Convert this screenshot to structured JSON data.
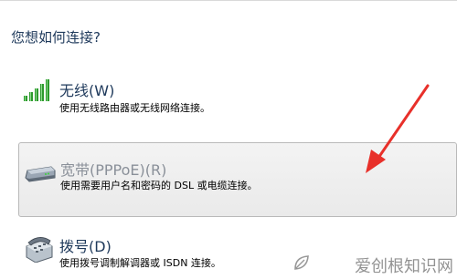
{
  "header": {
    "title": "您想如何连接?"
  },
  "options": [
    {
      "title": "无线(W)",
      "description": "使用无线路由器或无线网络连接。",
      "icon": "wifi-signal-icon"
    },
    {
      "title": "宽带(PPPoE)(R)",
      "description": "使用需要用户名和密码的 DSL 或电缆连接。",
      "icon": "modem-icon"
    },
    {
      "title": "拨号(D)",
      "description": "使用拨号调制解调器或 ISDN 连接。",
      "icon": "telephone-icon"
    }
  ],
  "watermark": {
    "text": "爱创根知识网",
    "icon": "leaf-logo-icon"
  },
  "colors": {
    "title": "#1e395b",
    "arrow": "#e8302a",
    "highlight_border": "#b9b9b9"
  }
}
